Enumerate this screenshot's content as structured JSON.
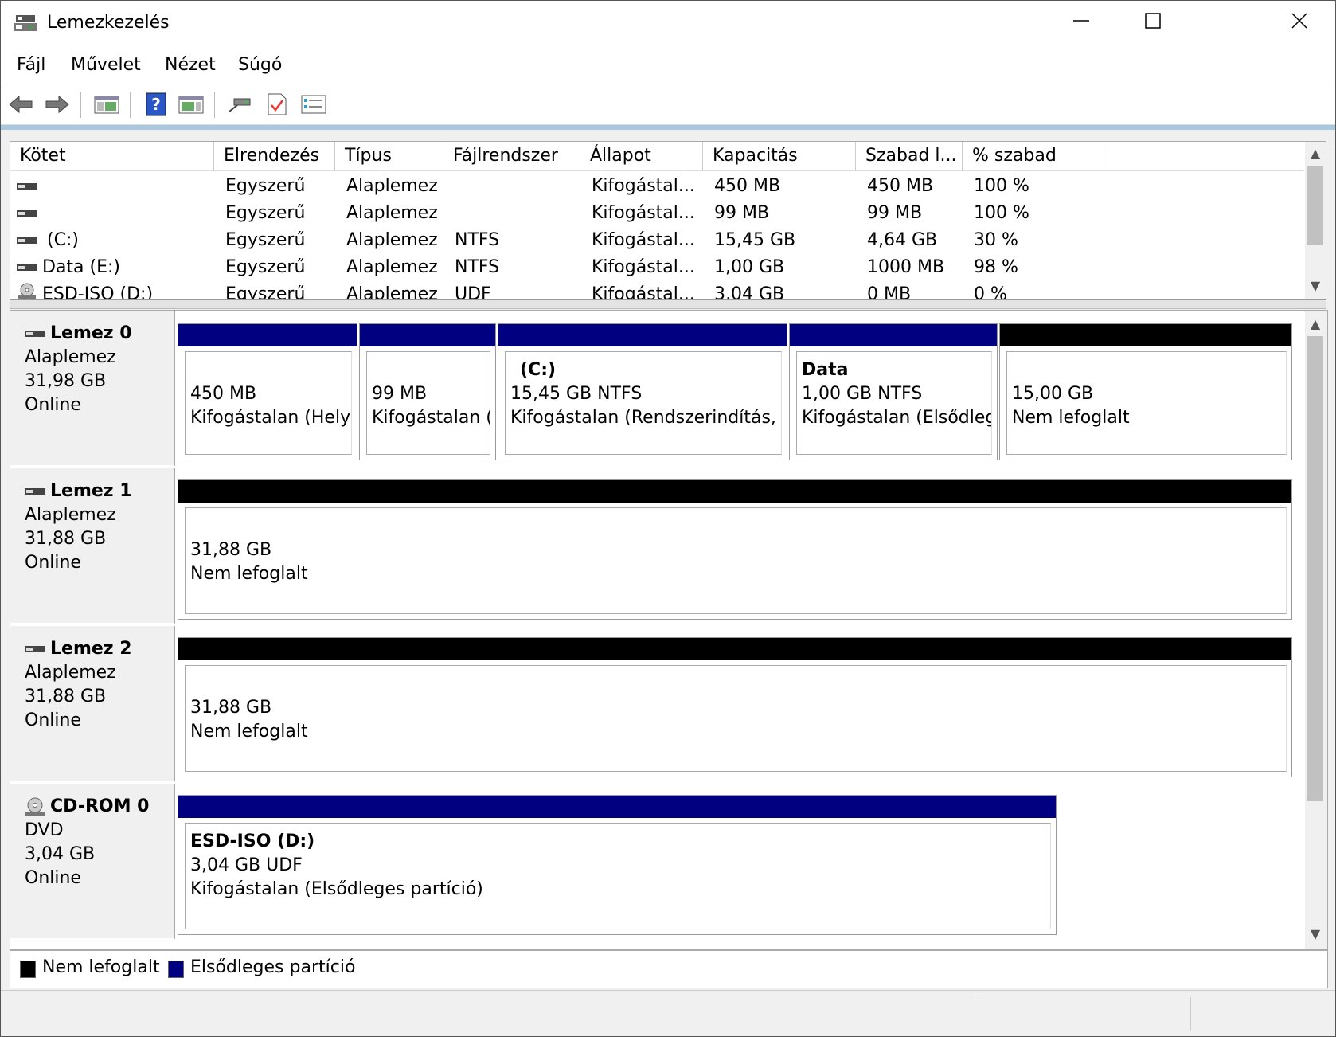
{
  "window": {
    "title": "Lemezkezelés"
  },
  "menu": [
    "Fájl",
    "Művelet",
    "Nézet",
    "Súgó"
  ],
  "toolbar": {
    "icons": [
      "back-arrow-icon",
      "forward-arrow-icon",
      "console-tree-icon",
      "help-icon",
      "properties-view-icon",
      "connect-icon",
      "checklist-icon",
      "task-list-icon"
    ]
  },
  "volumes": {
    "columns": [
      "Kötet",
      "Elrendezés",
      "Típus",
      "Fájlrendszer",
      "Állapot",
      "Kapacitás",
      "Szabad l...",
      "% szabad"
    ],
    "rows": [
      {
        "name": "",
        "layout": "Egyszerű",
        "type": "Alaplemez",
        "fs": "",
        "status": "Kifogástal...",
        "capacity": "450 MB",
        "free": "450 MB",
        "pct": "100 %",
        "icon": "disk"
      },
      {
        "name": "",
        "layout": "Egyszerű",
        "type": "Alaplemez",
        "fs": "",
        "status": "Kifogástal...",
        "capacity": "99 MB",
        "free": "99 MB",
        "pct": "100 %",
        "icon": "disk"
      },
      {
        "name": "(C:)",
        "layout": "Egyszerű",
        "type": "Alaplemez",
        "fs": "NTFS",
        "status": "Kifogástal...",
        "capacity": "15,45 GB",
        "free": "4,64 GB",
        "pct": "30 %",
        "icon": "disk"
      },
      {
        "name": "Data (E:)",
        "layout": "Egyszerű",
        "type": "Alaplemez",
        "fs": "NTFS",
        "status": "Kifogástal...",
        "capacity": "1,00 GB",
        "free": "1000 MB",
        "pct": "98 %",
        "icon": "disk"
      },
      {
        "name": "ESD-ISO (D:)",
        "layout": "Egyszerű",
        "type": "Alaplemez",
        "fs": "UDF",
        "status": "Kifogástal...",
        "capacity": "3,04 GB",
        "free": "0 MB",
        "pct": "0 %",
        "icon": "cd"
      }
    ]
  },
  "disks": [
    {
      "name": "Lemez 0",
      "kind": "Alaplemez",
      "size": "31,98 GB",
      "state": "Online",
      "partitions": [
        {
          "title": "",
          "line1": "450 MB",
          "line2": "Kifogástalan (Helyr"
        },
        {
          "title": "",
          "line1": "99 MB",
          "line2": "Kifogástalan ("
        },
        {
          "title": "(C:)",
          "line1": "15,45 GB NTFS",
          "line2": "Kifogástalan (Rendszerindítás, La"
        },
        {
          "title": "Data",
          "line1": "1,00 GB NTFS",
          "line2": "Kifogástalan (Elsődleg"
        },
        {
          "title": "",
          "line1": "15,00 GB",
          "line2": "Nem lefoglalt"
        }
      ]
    },
    {
      "name": "Lemez 1",
      "kind": "Alaplemez",
      "size": "31,88 GB",
      "state": "Online",
      "partitions": [
        {
          "title": "",
          "line1": "31,88 GB",
          "line2": "Nem lefoglalt"
        }
      ]
    },
    {
      "name": "Lemez 2",
      "kind": "Alaplemez",
      "size": "31,88 GB",
      "state": "Online",
      "partitions": [
        {
          "title": "",
          "line1": "31,88 GB",
          "line2": "Nem lefoglalt"
        }
      ]
    },
    {
      "name": "CD-ROM 0",
      "kind": "DVD",
      "size": "3,04 GB",
      "state": "Online",
      "partitions": [
        {
          "title": "ESD-ISO  (D:)",
          "line1": "3,04 GB UDF",
          "line2": "Kifogástalan (Elsődleges partíció)"
        }
      ]
    }
  ],
  "legend": {
    "unallocated": "Nem lefoglalt",
    "primary": "Elsődleges partíció"
  },
  "colors": {
    "primary": "#000080",
    "unallocated": "#000000"
  }
}
